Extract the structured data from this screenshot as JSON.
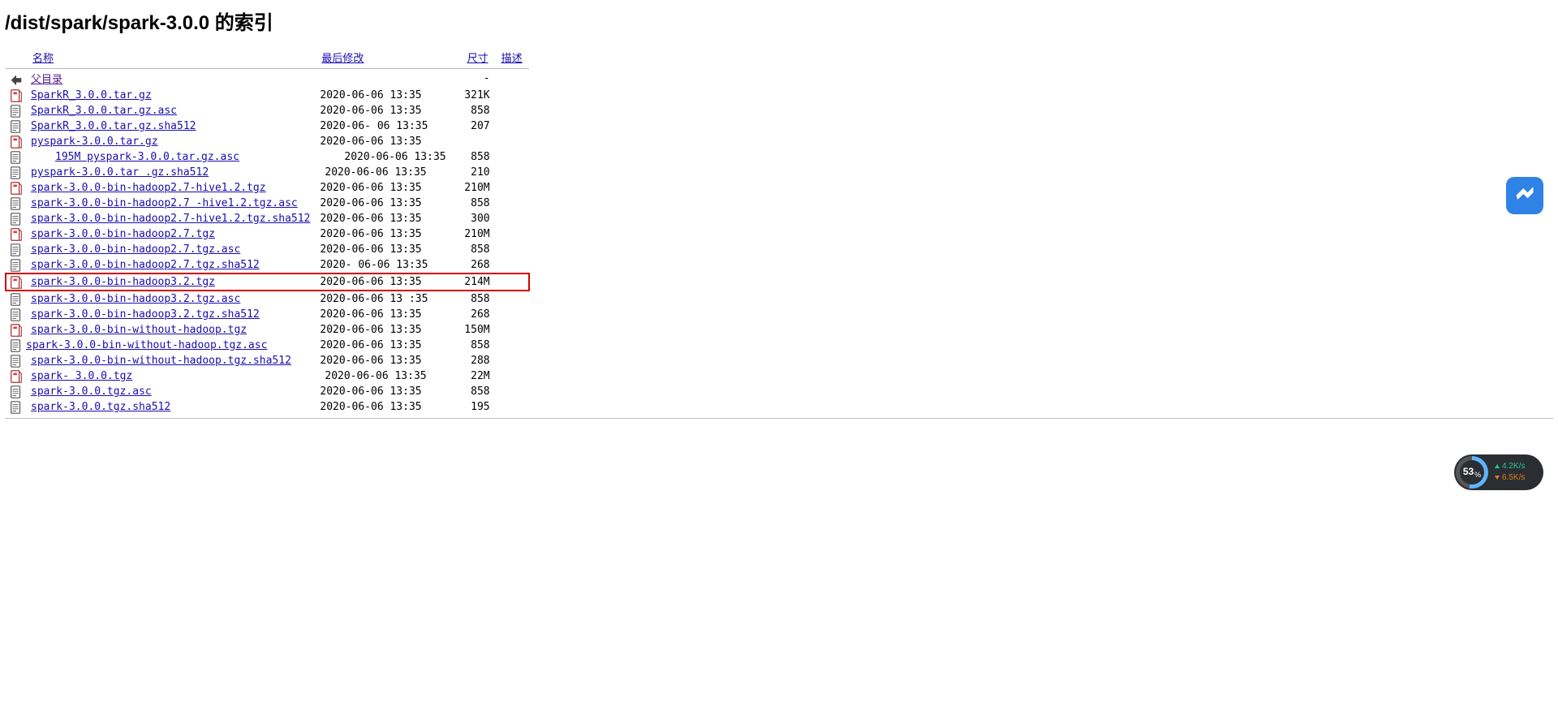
{
  "title": "/dist/spark/spark-3.0.0 的索引",
  "headers": {
    "name": "名称",
    "modified": "最后修改",
    "size": "尺寸",
    "desc": "描述"
  },
  "parent": {
    "label": "父目录",
    "size": "-"
  },
  "files": [
    {
      "icon": "archive",
      "name": "SparkR_3.0.0.tar.gz",
      "date": "2020-06-06 13:35",
      "size": "321K",
      "hl": false,
      "visited": false
    },
    {
      "icon": "text",
      "name": "SparkR_3.0.0.tar.gz.asc",
      "date": "2020-06-06 13:35",
      "size": "858",
      "hl": false,
      "visited": false
    },
    {
      "icon": "text",
      "name": "SparkR_3.0.0.tar.gz.sha512",
      "date": "2020-06- 06 13:35",
      "size": "207",
      "hl": false,
      "visited": false
    },
    {
      "icon": "archive",
      "name": "pyspark-3.0.0.tar.gz",
      "date": "2020-06-06 13:35",
      "size": "",
      "hl": false,
      "visited": false
    },
    {
      "icon": "text",
      "name": "195M pyspark-3.0.0.tar.gz.asc",
      "date": "2020-06-06 13:35",
      "size": "858",
      "hl": false,
      "visited": false,
      "indent": true
    },
    {
      "icon": "text",
      "name": "pyspark-3.0.0.tar .gz.sha512",
      "date": "2020-06-06 13:35",
      "size": "210",
      "hl": false,
      "visited": false,
      "slight": true
    },
    {
      "icon": "archive",
      "name": "spark-3.0.0-bin-hadoop2.7-hive1.2.tgz",
      "date": "2020-06-06 13:35",
      "size": "210M",
      "hl": false,
      "visited": false
    },
    {
      "icon": "text",
      "name": "spark-3.0.0-bin-hadoop2.7 -hive1.2.tgz.asc",
      "date": "2020-06-06 13:35",
      "size": "858",
      "hl": false,
      "visited": false
    },
    {
      "icon": "text",
      "name": "spark-3.0.0-bin-hadoop2.7-hive1.2.tgz.sha512",
      "date": "2020-06-06 13:35",
      "size": "300",
      "hl": false,
      "visited": false
    },
    {
      "icon": "archive",
      "name": "spark-3.0.0-bin-hadoop2.7.tgz",
      "date": "2020-06-06 13:35",
      "size": "210M",
      "hl": false,
      "visited": false
    },
    {
      "icon": "text",
      "name": "spark-3.0.0-bin-hadoop2.7.tgz.asc",
      "date": "2020-06-06 13:35",
      "size": "858",
      "hl": false,
      "visited": false
    },
    {
      "icon": "text",
      "name": "spark-3.0.0-bin-hadoop2.7.tgz.sha512",
      "date": "2020- 06-06 13:35",
      "size": "268",
      "hl": false,
      "visited": false
    },
    {
      "icon": "archive",
      "name": "spark-3.0.0-bin-hadoop3.2.tgz",
      "date": "2020-06-06 13:35",
      "size": "214M",
      "hl": true,
      "visited": false
    },
    {
      "icon": "text",
      "name": "spark-3.0.0-bin-hadoop3.2.tgz.asc",
      "date": "2020-06-06 13 :35",
      "size": "858",
      "hl": false,
      "visited": false
    },
    {
      "icon": "text",
      "name": "spark-3.0.0-bin-hadoop3.2.tgz.sha512",
      "date": "2020-06-06 13:35",
      "size": "268",
      "hl": false,
      "visited": false
    },
    {
      "icon": "archive",
      "name": "spark-3.0.0-bin-without-hadoop.tgz",
      "date": "2020-06-06 13:35",
      "size": "150M",
      "hl": false,
      "visited": false
    },
    {
      "icon": "text",
      "name": "spark-3.0.0-bin-without-hadoop.tgz.asc",
      "date": "2020-06-06 13:35",
      "size": "858",
      "hl": false,
      "visited": false,
      "unindent": true
    },
    {
      "icon": "text",
      "name": "spark-3.0.0-bin-without-hadoop.tgz.sha512",
      "date": "2020-06-06 13:35",
      "size": "288",
      "hl": false,
      "visited": false
    },
    {
      "icon": "archive",
      "name": "spark- 3.0.0.tgz",
      "date": "2020-06-06 13:35",
      "size": "22M",
      "hl": false,
      "visited": false,
      "slight": true
    },
    {
      "icon": "text",
      "name": "spark-3.0.0.tgz.asc",
      "date": "2020-06-06 13:35",
      "size": "858",
      "hl": false,
      "visited": false
    },
    {
      "icon": "text",
      "name": "spark-3.0.0.tgz.sha512",
      "date": "2020-06-06 13:35",
      "size": "195",
      "hl": false,
      "visited": false
    }
  ],
  "netmon": {
    "percent": "53",
    "up": "4.2K/s",
    "down": "6.5K/s"
  }
}
